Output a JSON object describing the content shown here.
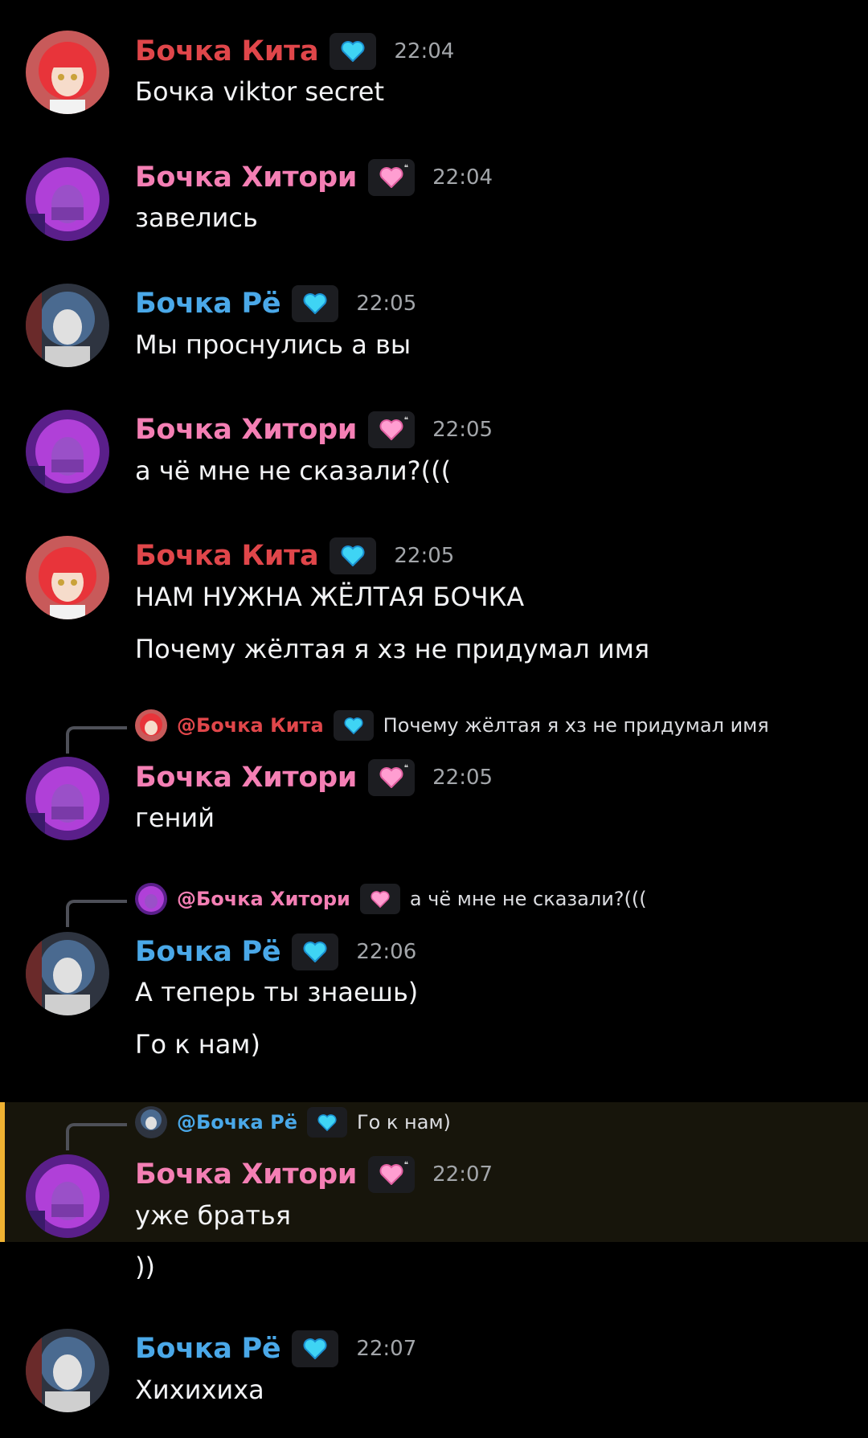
{
  "colors": {
    "kita": "#e0464a",
    "hitori": "#f47fb4",
    "ryo": "#4aa8e8",
    "highlight_bar": "#f0b232"
  },
  "messages": [
    {
      "author": "Бочка Кита",
      "badge": "blue-heart-icon",
      "time": "22:04",
      "lines": [
        "Бочка viktor secret"
      ]
    },
    {
      "author": "Бочка Хитори",
      "badge": "pink-heart-icon",
      "time": "22:04",
      "lines": [
        "завелись"
      ]
    },
    {
      "author": "Бочка Рё",
      "badge": "blue-heart-icon",
      "time": "22:05",
      "lines": [
        "Мы проснулись а вы"
      ]
    },
    {
      "author": "Бочка Хитори",
      "badge": "pink-heart-icon",
      "time": "22:05",
      "lines": [
        "а чё мне не сказали?((("
      ]
    },
    {
      "author": "Бочка Кита",
      "badge": "blue-heart-icon",
      "time": "22:05",
      "lines": [
        "НАМ НУЖНА ЖЁЛТАЯ БОЧКА",
        "Почему жёлтая я хз не придумал имя"
      ]
    },
    {
      "reply": {
        "name": "@Бочка Кита",
        "text": "Почему жёлтая я хз не придумал имя"
      },
      "author": "Бочка Хитори",
      "badge": "pink-heart-icon",
      "time": "22:05",
      "lines": [
        "гений"
      ]
    },
    {
      "reply": {
        "name": "@Бочка Хитори",
        "text": "а чё мне не сказали?((("
      },
      "author": "Бочка Рё",
      "badge": "blue-heart-icon",
      "time": "22:06",
      "lines": [
        "А теперь ты знаешь)",
        "Го к нам)"
      ]
    },
    {
      "reply": {
        "name": "@Бочка Рё",
        "text": "Го к нам)"
      },
      "author": "Бочка Хитори",
      "badge": "pink-heart-icon",
      "time": "22:07",
      "lines": [
        "уже братья",
        "))"
      ],
      "highlighted": true
    },
    {
      "author": "Бочка Рё",
      "badge": "blue-heart-icon",
      "time": "22:07",
      "lines": [
        "Хихихиха"
      ]
    }
  ]
}
